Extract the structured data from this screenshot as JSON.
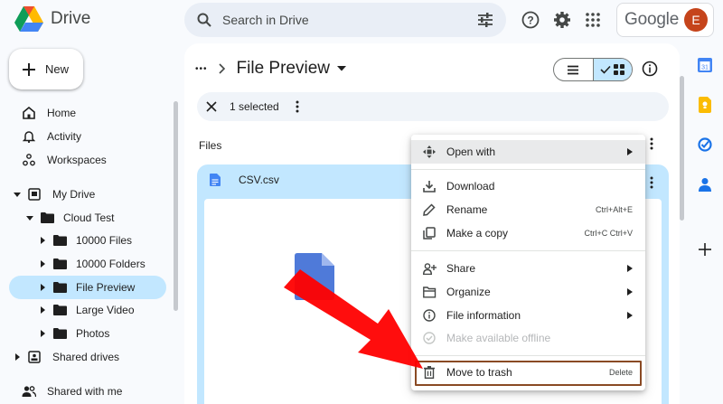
{
  "app": {
    "name": "Drive"
  },
  "search": {
    "placeholder": "Search in Drive"
  },
  "account": {
    "brand": "Google",
    "initial": "E"
  },
  "sidebar": {
    "new_label": "New",
    "items": [
      {
        "label": "Home",
        "icon": "home-icon"
      },
      {
        "label": "Activity",
        "icon": "bell-icon"
      },
      {
        "label": "Workspaces",
        "icon": "workspaces-icon"
      },
      {
        "label": "My Drive",
        "icon": "drive-icon"
      },
      {
        "label": "Cloud Test",
        "icon": "folder-icon"
      },
      {
        "label": "10000 Files",
        "icon": "folder-icon"
      },
      {
        "label": "10000 Folders",
        "icon": "folder-icon"
      },
      {
        "label": "File Preview",
        "icon": "folder-icon"
      },
      {
        "label": "Large Video",
        "icon": "folder-icon"
      },
      {
        "label": "Photos",
        "icon": "folder-icon"
      },
      {
        "label": "Shared drives",
        "icon": "shared-drives-icon"
      },
      {
        "label": "Shared with me",
        "icon": "people-icon"
      }
    ]
  },
  "main": {
    "breadcrumb_more": "•••",
    "title": "File Preview",
    "selection": "1 selected",
    "section_label": "Files",
    "file": {
      "name": "CSV.csv"
    }
  },
  "menu": {
    "items": [
      {
        "label": "Open with",
        "shortcut": "",
        "submenu": true
      },
      {
        "label": "Download",
        "shortcut": ""
      },
      {
        "label": "Rename",
        "shortcut": "Ctrl+Alt+E"
      },
      {
        "label": "Make a copy",
        "shortcut": "Ctrl+C Ctrl+V"
      },
      {
        "label": "Share",
        "shortcut": "",
        "submenu": true
      },
      {
        "label": "Organize",
        "shortcut": "",
        "submenu": true
      },
      {
        "label": "File information",
        "shortcut": "",
        "submenu": true
      },
      {
        "label": "Make available offline",
        "shortcut": "",
        "disabled": true
      },
      {
        "label": "Move to trash",
        "shortcut": "Delete"
      }
    ]
  },
  "colors": {
    "accent": "#c2e7ff",
    "highlight_box": "#8a4a24",
    "arrow": "#ff0000"
  }
}
